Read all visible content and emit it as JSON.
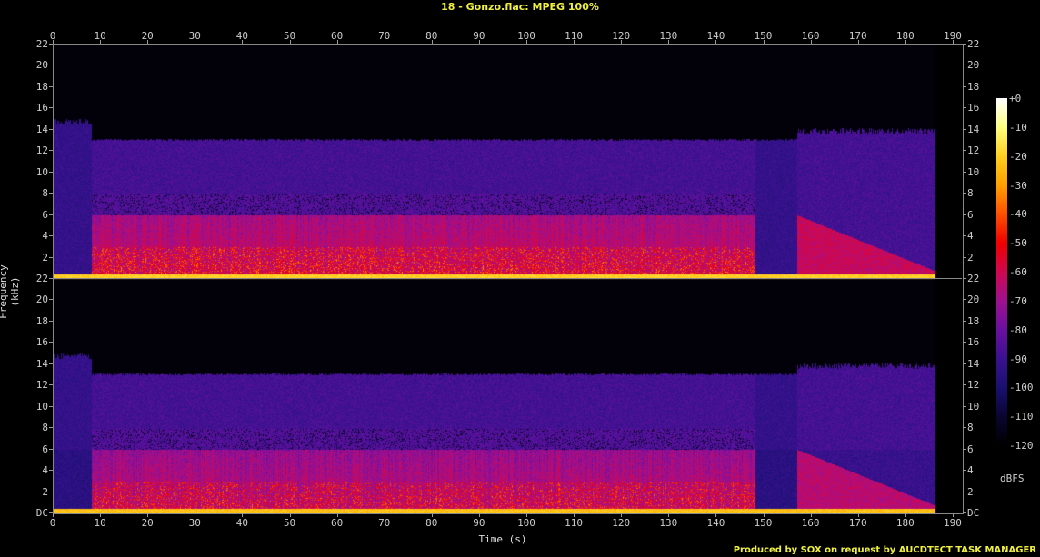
{
  "chart_data": {
    "type": "heatmap",
    "title": "18 - Gonzo.flac: MPEG 100%",
    "xlabel": "Time (s)",
    "ylabel": "Frequency (kHz)",
    "xlim": [
      0,
      192
    ],
    "ylim": [
      0,
      22.05
    ],
    "x_ticks": [
      "0",
      "10",
      "20",
      "30",
      "40",
      "50",
      "60",
      "70",
      "80",
      "90",
      "100",
      "110",
      "120",
      "130",
      "140",
      "150",
      "160",
      "170",
      "180",
      "190"
    ],
    "y_ticks_upper": [
      "22",
      "20",
      "18",
      "16",
      "14",
      "12",
      "10",
      "8",
      "6",
      "4",
      "2"
    ],
    "y_ticks_lower": [
      "22",
      "20",
      "18",
      "16",
      "14",
      "12",
      "10",
      "8",
      "6",
      "4",
      "2",
      "DC"
    ],
    "channels": 2,
    "colorbar": {
      "unit": "dBFS",
      "ticks": [
        "+0",
        "-10",
        "-20",
        "-30",
        "-40",
        "-50",
        "-60",
        "-70",
        "-80",
        "-90",
        "-100",
        "-110",
        "-120"
      ],
      "range": [
        -120,
        0
      ]
    },
    "features": {
      "signal_end_s": 186,
      "lowpass_cutoff_khz": 13,
      "intro_cutoff_khz": 15,
      "quiet_section_s": [
        148,
        157
      ]
    }
  },
  "footer": {
    "credit": "Produced by SOX on request by AUCDTECT TASK MANAGER"
  }
}
